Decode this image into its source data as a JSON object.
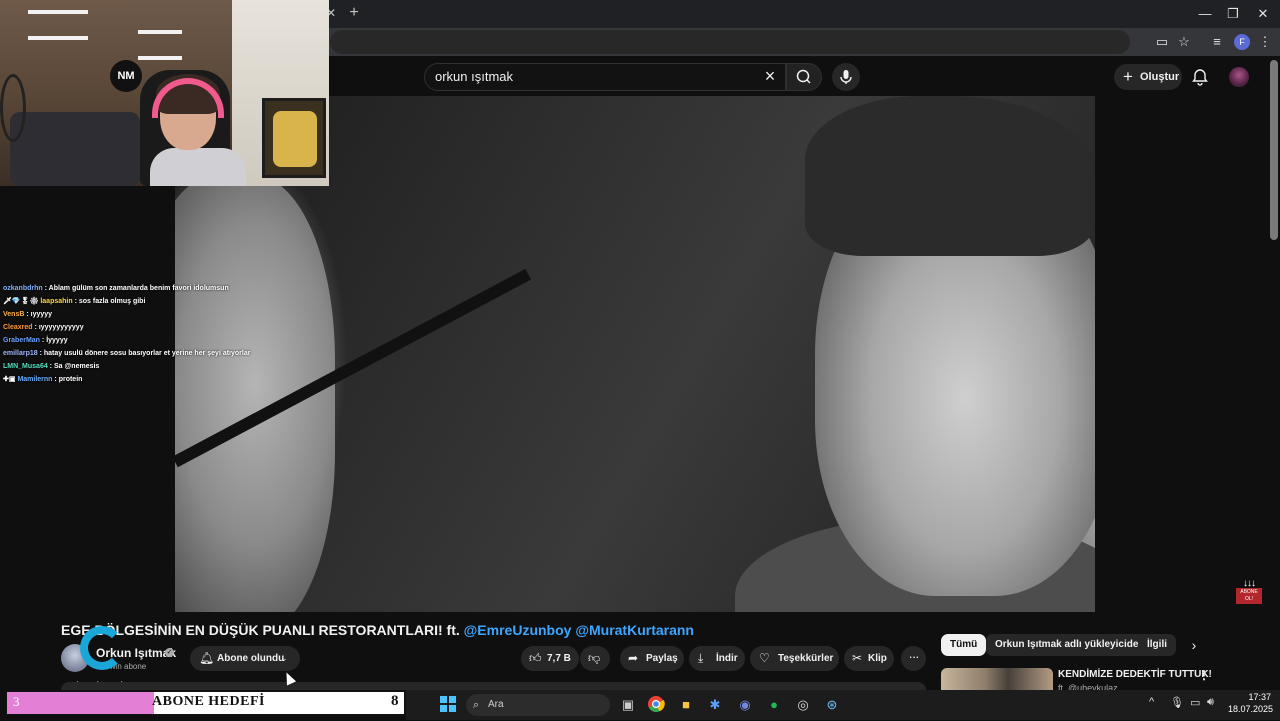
{
  "youtube": {
    "search_value": "orkun ışıtmak",
    "create_label": "Oluştur"
  },
  "video": {
    "title_main": "EGE BÖLGESİNİN EN DÜŞÜK PUANLI RESTORANTLARI! ft.",
    "title_mentions": [
      "@EmreUzunboy",
      "@MuratKurtarann"
    ],
    "subscribe_overlay_text": "ABONE OL!"
  },
  "channel": {
    "name": "Orkun Işıtmak",
    "subscribers": "9 Mn abone",
    "subscribe_label": "Abone olundu"
  },
  "actions": {
    "likes": "7,7 B",
    "share": "Paylaş",
    "download": "İndir",
    "thanks": "Teşekkürler",
    "clip": "Klip"
  },
  "chips": [
    "Tümü",
    "Orkun Işıtmak adlı yükleyiciden",
    "İlgili"
  ],
  "recommendation": {
    "title": "KENDİMİZE DEDEKTİF TUTTUK!",
    "subtitle": "ft. @ubeykulaz"
  },
  "chat": [
    {
      "user": "ozkanbdrhn",
      "user_color": "#7fb3ff",
      "badges": "",
      "message": "Ablam gülüm son zamanlarda benim favori idolumsun"
    },
    {
      "user": "laapsahin",
      "user_color": "#ffd84a",
      "badges": "🗡💎🎖⚙",
      "message": "sos fazla olmuş gibi"
    },
    {
      "user": "VensB",
      "user_color": "#ffb04a",
      "badges": "",
      "message": "ıyyyyy"
    },
    {
      "user": "Cleaxred",
      "user_color": "#ff9a3a",
      "badges": "",
      "message": "ıyyyyyyyyyyy"
    },
    {
      "user": "GraberMan",
      "user_color": "#6aa0ff",
      "badges": "",
      "message": "İyyyyy"
    },
    {
      "user": "emillarp18",
      "user_color": "#9fb7ff",
      "badges": "",
      "message": "hatay usulü dönere sosu basıyorlar et yerine her şeyi atıyorlar"
    },
    {
      "user": "LMN_Musa64",
      "user_color": "#56e0c0",
      "badges": "",
      "message": "Sa @nemesis"
    },
    {
      "user": "Mamilernn",
      "user_color": "#6ab0ff",
      "badges": "✚▣",
      "message": "protein"
    }
  ],
  "goal": {
    "current": "3",
    "title": "ABONE HEDEFİ",
    "target": "8",
    "progress_fraction": 0.37,
    "fill_color": "#e47fd6"
  },
  "overlay": {
    "sponsor_logo_text": "logitech",
    "webcam_logo_text": "NM"
  },
  "taskbar": {
    "search_placeholder": "Ara",
    "time": "17:37",
    "date": "18.07.2025"
  },
  "colors": {
    "accent_link": "#3ea6ff",
    "youtube_bg": "#0f0f0f",
    "logitech": "#1aa7d8"
  }
}
